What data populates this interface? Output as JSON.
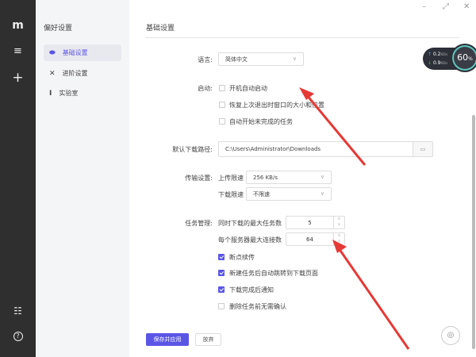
{
  "rail": {
    "icons": [
      "logo-icon",
      "menu-icon",
      "plus-icon",
      "settings-sliders-icon",
      "help-icon"
    ]
  },
  "sidebar": {
    "title": "偏好设置",
    "items": [
      {
        "label": "基础设置",
        "icon": "toggle-icon",
        "active": true
      },
      {
        "label": "进阶设置",
        "icon": "tools-icon"
      },
      {
        "label": "实验室",
        "icon": "flask-icon"
      }
    ]
  },
  "main": {
    "title": "基础设置",
    "language": {
      "label": "语言:",
      "value": "简体中文"
    },
    "startup": {
      "label": "启动:",
      "options": [
        {
          "label": "开机自动启动",
          "checked": false
        },
        {
          "label": "恢复上次退出时窗口的大小和位置",
          "checked": false
        },
        {
          "label": "自动开始未完成的任务",
          "checked": false
        }
      ]
    },
    "download_path": {
      "label": "默认下载路径:",
      "value": "C:\\Users\\Administrator\\Downloads"
    },
    "transfer": {
      "label": "传输设置:",
      "upload_label": "上传限速",
      "upload_value": "256 KB/s",
      "download_label": "下载限速",
      "download_value": "不限速"
    },
    "tasks": {
      "label": "任务管理:",
      "max_tasks_label": "同时下载的最大任务数",
      "max_tasks": "5",
      "max_conn_label": "每个服务器最大连接数",
      "max_conn": "64",
      "options": [
        {
          "label": "断点续传",
          "checked": true
        },
        {
          "label": "新建任务后自动跳转到下载页面",
          "checked": true
        },
        {
          "label": "下载完成后通知",
          "checked": true
        },
        {
          "label": "删除任务前无需确认",
          "checked": false
        }
      ]
    },
    "save_label": "保存并应用",
    "discard_label": "放弃"
  },
  "speed": {
    "upload": "0.2",
    "upload_unit": "KB/s",
    "download": "0.9",
    "download_unit": "KB/s",
    "percent": "60",
    "percent_unit": "%"
  },
  "colors": {
    "accent": "#5b55e6",
    "rail": "#2f2f2f",
    "annotation": "#e53935"
  }
}
